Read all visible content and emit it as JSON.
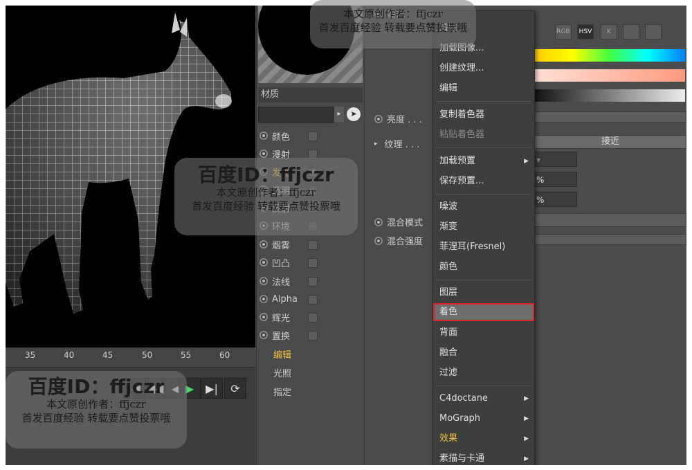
{
  "timeline": {
    "ticks": [
      "35",
      "40",
      "45",
      "50",
      "55",
      "60"
    ],
    "buttons": [
      "|◀",
      "◀◀",
      "◀",
      "▶",
      "▶|",
      "⟳"
    ]
  },
  "material": {
    "label": "材质",
    "channels": [
      {
        "label": "颜色",
        "checked": false
      },
      {
        "label": "漫射",
        "checked": false
      },
      {
        "label": "发光",
        "checked": true
      },
      {
        "label": "透明",
        "checked": false
      },
      {
        "label": "反射",
        "checked": false
      },
      {
        "label": "环境",
        "checked": false
      },
      {
        "label": "烟雾",
        "checked": false
      },
      {
        "label": "凹凸",
        "checked": false
      },
      {
        "label": "法线",
        "checked": false
      },
      {
        "label": "Alpha",
        "checked": false
      },
      {
        "label": "辉光",
        "checked": false
      },
      {
        "label": "置换",
        "checked": false
      }
    ],
    "sub_items": [
      "编辑",
      "光照",
      "指定"
    ]
  },
  "properties": {
    "top": "颜色",
    "brightness": "亮度 . . .",
    "texture": "纹理 . . .",
    "blend_mode": "混合模式",
    "blend_strength": "混合强度"
  },
  "menu": {
    "group1": [
      "清除",
      "加载图像...",
      "创建纹理...",
      "编辑"
    ],
    "group2": [
      "复制着色器",
      "粘贴着色器"
    ],
    "group3": [
      "加载预置",
      "保存预置..."
    ],
    "group4": [
      "噪波",
      "渐变",
      "菲涅耳(Fresnel)",
      "颜色"
    ],
    "group5": [
      "图层",
      "着色",
      "背面",
      "融合",
      "过滤"
    ],
    "group6": [
      "C4doctane",
      "MoGraph",
      "效果",
      "素描与卡通"
    ]
  },
  "right_panel": {
    "color_modes": [
      "RGB",
      "HSV",
      "K",
      "",
      ""
    ],
    "active_mode": "HSV",
    "approx_label": "接近",
    "percent1": "%",
    "percent2": "%"
  },
  "watermark": {
    "title": "百度ID：ffjczr",
    "author": "本文原创作者：ffjczr",
    "note": "首发百度经验 转载要点赞投票哦",
    "partial_title": "百度ID：ffjczr",
    "partial_author": "本文原创作者：ffjczr",
    "partial_note": "首发百度经验 转载要点赞投票哦"
  }
}
